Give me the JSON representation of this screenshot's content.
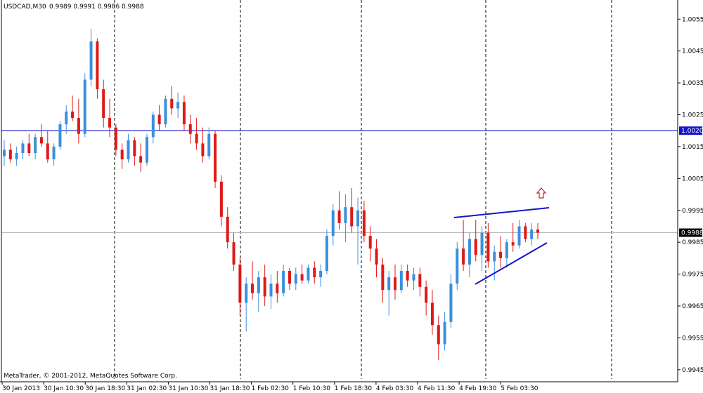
{
  "header": {
    "symbol": "USDCAD,M30",
    "ohlc": "0.9989 0.9991 0.9986 0.9988"
  },
  "copyright": "MetaTrader, © 2001-2012, MetaQuotes Software Corp.",
  "colors": {
    "background": "#ffffff",
    "up_candle": "#3a8fde",
    "down_candle": "#e01818",
    "hline": "#1515c8",
    "current_line": "#b8b8b8",
    "arrow": "#e01818",
    "triangle": "#1515c8"
  },
  "chart_data": {
    "type": "candlestick",
    "ylim": [
      0.9941,
      1.0061
    ],
    "y_ticks": [
      "1.0055",
      "1.0045",
      "1.0035",
      "1.0025",
      "1.0015",
      "1.0005",
      "0.9995",
      "0.9985",
      "0.9975",
      "0.9965",
      "0.9955",
      "0.9945"
    ],
    "x_labels": [
      "30 Jan 2013",
      "30 Jan 10:30",
      "30 Jan 18:30",
      "31 Jan 02:30",
      "31 Jan 10:30",
      "31 Jan 18:30",
      "1 Feb 02:30",
      "1 Feb 10:30",
      "1 Feb 18:30",
      "4 Feb 03:30",
      "4 Feb 11:30",
      "4 Feb 19:30",
      "5 Feb 03:30"
    ],
    "horizontal_line": {
      "value": 1.002,
      "label": "1.0020"
    },
    "current_price": {
      "value": 0.9988,
      "label": "0.9988"
    },
    "ohlc": [
      {
        "o": 1.0012,
        "h": 1.0017,
        "l": 1.0009,
        "c": 1.0014
      },
      {
        "o": 1.0014,
        "h": 1.0016,
        "l": 1.001,
        "c": 1.0011
      },
      {
        "o": 1.0011,
        "h": 1.0015,
        "l": 1.0009,
        "c": 1.0013
      },
      {
        "o": 1.0013,
        "h": 1.0017,
        "l": 1.0011,
        "c": 1.0016
      },
      {
        "o": 1.0016,
        "h": 1.0019,
        "l": 1.0012,
        "c": 1.0013
      },
      {
        "o": 1.0013,
        "h": 1.0019,
        "l": 1.0011,
        "c": 1.0018
      },
      {
        "o": 1.0018,
        "h": 1.0022,
        "l": 1.0015,
        "c": 1.0016
      },
      {
        "o": 1.0016,
        "h": 1.002,
        "l": 1.001,
        "c": 1.0011
      },
      {
        "o": 1.0011,
        "h": 1.0016,
        "l": 1.0009,
        "c": 1.0015
      },
      {
        "o": 1.0015,
        "h": 1.0023,
        "l": 1.0014,
        "c": 1.0022
      },
      {
        "o": 1.0022,
        "h": 1.0028,
        "l": 1.0019,
        "c": 1.0026
      },
      {
        "o": 1.0026,
        "h": 1.0031,
        "l": 1.0023,
        "c": 1.0024
      },
      {
        "o": 1.0024,
        "h": 1.003,
        "l": 1.0016,
        "c": 1.0019
      },
      {
        "o": 1.0019,
        "h": 1.0038,
        "l": 1.0018,
        "c": 1.0036
      },
      {
        "o": 1.0036,
        "h": 1.0052,
        "l": 1.0034,
        "c": 1.0048
      },
      {
        "o": 1.0048,
        "h": 1.0049,
        "l": 1.003,
        "c": 1.0033
      },
      {
        "o": 1.0033,
        "h": 1.0036,
        "l": 1.0021,
        "c": 1.0024
      },
      {
        "o": 1.0024,
        "h": 1.003,
        "l": 1.0018,
        "c": 1.0021
      },
      {
        "o": 1.0021,
        "h": 1.0022,
        "l": 1.0012,
        "c": 1.0014
      },
      {
        "o": 1.0014,
        "h": 1.0016,
        "l": 1.0008,
        "c": 1.0011
      },
      {
        "o": 1.0011,
        "h": 1.0019,
        "l": 1.001,
        "c": 1.0017
      },
      {
        "o": 1.0017,
        "h": 1.0018,
        "l": 1.0009,
        "c": 1.0012
      },
      {
        "o": 1.0012,
        "h": 1.0016,
        "l": 1.0007,
        "c": 1.001
      },
      {
        "o": 1.001,
        "h": 1.0019,
        "l": 1.0009,
        "c": 1.0018
      },
      {
        "o": 1.0018,
        "h": 1.0026,
        "l": 1.0016,
        "c": 1.0025
      },
      {
        "o": 1.0025,
        "h": 1.0028,
        "l": 1.002,
        "c": 1.0022
      },
      {
        "o": 1.0022,
        "h": 1.0031,
        "l": 1.0021,
        "c": 1.003
      },
      {
        "o": 1.003,
        "h": 1.0034,
        "l": 1.0025,
        "c": 1.0027
      },
      {
        "o": 1.0027,
        "h": 1.0032,
        "l": 1.0024,
        "c": 1.0029
      },
      {
        "o": 1.0029,
        "h": 1.0031,
        "l": 1.002,
        "c": 1.0022
      },
      {
        "o": 1.0022,
        "h": 1.0025,
        "l": 1.0016,
        "c": 1.0019
      },
      {
        "o": 1.0019,
        "h": 1.0024,
        "l": 1.0014,
        "c": 1.0016
      },
      {
        "o": 1.0016,
        "h": 1.0021,
        "l": 1.001,
        "c": 1.0012
      },
      {
        "o": 1.0012,
        "h": 1.0021,
        "l": 1.0011,
        "c": 1.0019
      },
      {
        "o": 1.0019,
        "h": 1.002,
        "l": 1.0002,
        "c": 1.0004
      },
      {
        "o": 1.0004,
        "h": 1.0006,
        "l": 0.999,
        "c": 0.9993
      },
      {
        "o": 0.9993,
        "h": 0.9996,
        "l": 0.9983,
        "c": 0.9985
      },
      {
        "o": 0.9985,
        "h": 0.9988,
        "l": 0.9976,
        "c": 0.9978
      },
      {
        "o": 0.9978,
        "h": 0.998,
        "l": 0.9962,
        "c": 0.9966
      },
      {
        "o": 0.9966,
        "h": 0.9974,
        "l": 0.9957,
        "c": 0.9972
      },
      {
        "o": 0.9972,
        "h": 0.9979,
        "l": 0.9967,
        "c": 0.9969
      },
      {
        "o": 0.9969,
        "h": 0.9976,
        "l": 0.9963,
        "c": 0.9974
      },
      {
        "o": 0.9974,
        "h": 0.9978,
        "l": 0.9965,
        "c": 0.9968
      },
      {
        "o": 0.9968,
        "h": 0.9975,
        "l": 0.9964,
        "c": 0.9972
      },
      {
        "o": 0.9972,
        "h": 0.9976,
        "l": 0.9966,
        "c": 0.9969
      },
      {
        "o": 0.9969,
        "h": 0.9978,
        "l": 0.9968,
        "c": 0.9976
      },
      {
        "o": 0.9976,
        "h": 0.9977,
        "l": 0.997,
        "c": 0.9972
      },
      {
        "o": 0.9972,
        "h": 0.9977,
        "l": 0.997,
        "c": 0.9975
      },
      {
        "o": 0.9975,
        "h": 0.9978,
        "l": 0.9972,
        "c": 0.9973
      },
      {
        "o": 0.9973,
        "h": 0.9978,
        "l": 0.9972,
        "c": 0.9977
      },
      {
        "o": 0.9977,
        "h": 0.9979,
        "l": 0.9972,
        "c": 0.9974
      },
      {
        "o": 0.9974,
        "h": 0.9978,
        "l": 0.9971,
        "c": 0.9976
      },
      {
        "o": 0.9976,
        "h": 0.9989,
        "l": 0.9975,
        "c": 0.9987
      },
      {
        "o": 0.9987,
        "h": 0.9997,
        "l": 0.9984,
        "c": 0.9995
      },
      {
        "o": 0.9995,
        "h": 1.0001,
        "l": 0.9989,
        "c": 0.9991
      },
      {
        "o": 0.9991,
        "h": 1.0,
        "l": 0.9985,
        "c": 0.9996
      },
      {
        "o": 0.9996,
        "h": 1.0002,
        "l": 0.9988,
        "c": 0.999
      },
      {
        "o": 0.999,
        "h": 0.9999,
        "l": 0.9978,
        "c": 0.9995
      },
      {
        "o": 0.9995,
        "h": 0.9998,
        "l": 0.9985,
        "c": 0.9987
      },
      {
        "o": 0.9987,
        "h": 0.999,
        "l": 0.9979,
        "c": 0.9983
      },
      {
        "o": 0.9983,
        "h": 0.9986,
        "l": 0.9974,
        "c": 0.9978
      },
      {
        "o": 0.9978,
        "h": 0.998,
        "l": 0.9966,
        "c": 0.997
      },
      {
        "o": 0.997,
        "h": 0.9976,
        "l": 0.9962,
        "c": 0.9974
      },
      {
        "o": 0.9974,
        "h": 0.9978,
        "l": 0.9967,
        "c": 0.997
      },
      {
        "o": 0.997,
        "h": 0.9978,
        "l": 0.9969,
        "c": 0.9976
      },
      {
        "o": 0.9976,
        "h": 0.9978,
        "l": 0.9971,
        "c": 0.9973
      },
      {
        "o": 0.9973,
        "h": 0.9977,
        "l": 0.997,
        "c": 0.9975
      },
      {
        "o": 0.9975,
        "h": 0.9977,
        "l": 0.9968,
        "c": 0.9971
      },
      {
        "o": 0.9971,
        "h": 0.9973,
        "l": 0.9962,
        "c": 0.9966
      },
      {
        "o": 0.9966,
        "h": 0.997,
        "l": 0.9956,
        "c": 0.9959
      },
      {
        "o": 0.9959,
        "h": 0.9962,
        "l": 0.9948,
        "c": 0.9953
      },
      {
        "o": 0.9953,
        "h": 0.9963,
        "l": 0.9951,
        "c": 0.996
      },
      {
        "o": 0.996,
        "h": 0.9975,
        "l": 0.9958,
        "c": 0.9972
      },
      {
        "o": 0.9972,
        "h": 0.9985,
        "l": 0.997,
        "c": 0.9983
      },
      {
        "o": 0.9983,
        "h": 0.9992,
        "l": 0.9976,
        "c": 0.9978
      },
      {
        "o": 0.9978,
        "h": 0.9988,
        "l": 0.9974,
        "c": 0.9986
      },
      {
        "o": 0.9986,
        "h": 0.9992,
        "l": 0.9979,
        "c": 0.9981
      },
      {
        "o": 0.9981,
        "h": 0.999,
        "l": 0.9976,
        "c": 0.9988
      },
      {
        "o": 0.9988,
        "h": 0.9991,
        "l": 0.9977,
        "c": 0.9979
      },
      {
        "o": 0.9979,
        "h": 0.9984,
        "l": 0.9973,
        "c": 0.9982
      },
      {
        "o": 0.9982,
        "h": 0.9987,
        "l": 0.9977,
        "c": 0.998
      },
      {
        "o": 0.998,
        "h": 0.9986,
        "l": 0.9977,
        "c": 0.9985
      },
      {
        "o": 0.9985,
        "h": 0.9991,
        "l": 0.9982,
        "c": 0.9984
      },
      {
        "o": 0.9984,
        "h": 0.9992,
        "l": 0.9983,
        "c": 0.999
      },
      {
        "o": 0.999,
        "h": 0.9991,
        "l": 0.9985,
        "c": 0.9986
      },
      {
        "o": 0.9986,
        "h": 0.9991,
        "l": 0.9984,
        "c": 0.9989
      },
      {
        "o": 0.9989,
        "h": 0.9991,
        "l": 0.9986,
        "c": 0.9988
      }
    ]
  }
}
